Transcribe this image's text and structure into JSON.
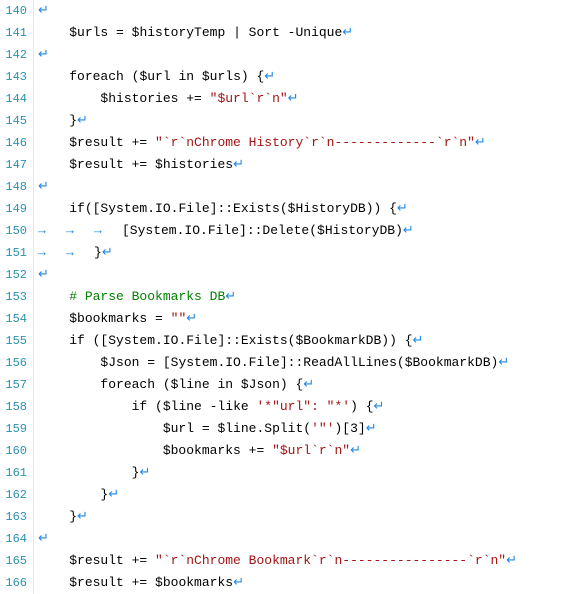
{
  "glyphs": {
    "eol": "↵",
    "tab": "→"
  },
  "lines": [
    {
      "num": 140,
      "indent": 0,
      "tabs": 0,
      "tokens": []
    },
    {
      "num": 141,
      "indent": 1,
      "tabs": 0,
      "tokens": [
        {
          "t": "var",
          "v": "$urls"
        },
        {
          "t": "plain",
          "v": " = "
        },
        {
          "t": "var",
          "v": "$historyTemp"
        },
        {
          "t": "plain",
          "v": " | Sort -Unique"
        }
      ]
    },
    {
      "num": 142,
      "indent": 0,
      "tabs": 0,
      "tokens": []
    },
    {
      "num": 143,
      "indent": 1,
      "tabs": 0,
      "tokens": [
        {
          "t": "kw",
          "v": "foreach"
        },
        {
          "t": "plain",
          "v": " ("
        },
        {
          "t": "var",
          "v": "$url"
        },
        {
          "t": "plain",
          "v": " in "
        },
        {
          "t": "var",
          "v": "$urls"
        },
        {
          "t": "plain",
          "v": ") {"
        }
      ]
    },
    {
      "num": 144,
      "indent": 2,
      "tabs": 0,
      "tokens": [
        {
          "t": "var",
          "v": "$histories"
        },
        {
          "t": "plain",
          "v": " += "
        },
        {
          "t": "str",
          "v": "\"$url`r`n\""
        }
      ]
    },
    {
      "num": 145,
      "indent": 1,
      "tabs": 0,
      "tokens": [
        {
          "t": "plain",
          "v": "}"
        }
      ]
    },
    {
      "num": 146,
      "indent": 1,
      "tabs": 0,
      "tokens": [
        {
          "t": "var",
          "v": "$result"
        },
        {
          "t": "plain",
          "v": " += "
        },
        {
          "t": "str",
          "v": "\"`r`nChrome History`r`n-------------`r`n\""
        }
      ]
    },
    {
      "num": 147,
      "indent": 1,
      "tabs": 0,
      "tokens": [
        {
          "t": "var",
          "v": "$result"
        },
        {
          "t": "plain",
          "v": " += "
        },
        {
          "t": "var",
          "v": "$histories"
        }
      ]
    },
    {
      "num": 148,
      "indent": 0,
      "tabs": 0,
      "tokens": []
    },
    {
      "num": 149,
      "indent": 1,
      "tabs": 0,
      "tokens": [
        {
          "t": "kw",
          "v": "if"
        },
        {
          "t": "plain",
          "v": "([System.IO.File]::Exists("
        },
        {
          "t": "var",
          "v": "$HistoryDB"
        },
        {
          "t": "plain",
          "v": ")) {"
        }
      ]
    },
    {
      "num": 150,
      "indent": 0,
      "tabs": 3,
      "tokens": [
        {
          "t": "plain",
          "v": "[System.IO.File]::Delete("
        },
        {
          "t": "var",
          "v": "$HistoryDB"
        },
        {
          "t": "plain",
          "v": ")"
        }
      ]
    },
    {
      "num": 151,
      "indent": 0,
      "tabs": 2,
      "tokens": [
        {
          "t": "plain",
          "v": "}"
        }
      ]
    },
    {
      "num": 152,
      "indent": 0,
      "tabs": 0,
      "tokens": []
    },
    {
      "num": 153,
      "indent": 1,
      "tabs": 0,
      "tokens": [
        {
          "t": "cmt",
          "v": "# Parse Bookmarks DB"
        }
      ]
    },
    {
      "num": 154,
      "indent": 1,
      "tabs": 0,
      "tokens": [
        {
          "t": "var",
          "v": "$bookmarks"
        },
        {
          "t": "plain",
          "v": " = "
        },
        {
          "t": "str",
          "v": "\"\""
        }
      ]
    },
    {
      "num": 155,
      "indent": 1,
      "tabs": 0,
      "tokens": [
        {
          "t": "kw",
          "v": "if"
        },
        {
          "t": "plain",
          "v": " ([System.IO.File]::Exists("
        },
        {
          "t": "var",
          "v": "$BookmarkDB"
        },
        {
          "t": "plain",
          "v": ")) {"
        }
      ]
    },
    {
      "num": 156,
      "indent": 2,
      "tabs": 0,
      "tokens": [
        {
          "t": "var",
          "v": "$Json"
        },
        {
          "t": "plain",
          "v": " = [System.IO.File]::ReadAllLines("
        },
        {
          "t": "var",
          "v": "$BookmarkDB"
        },
        {
          "t": "plain",
          "v": ")"
        }
      ]
    },
    {
      "num": 157,
      "indent": 2,
      "tabs": 0,
      "tokens": [
        {
          "t": "kw",
          "v": "foreach"
        },
        {
          "t": "plain",
          "v": " ("
        },
        {
          "t": "var",
          "v": "$line"
        },
        {
          "t": "plain",
          "v": " in "
        },
        {
          "t": "var",
          "v": "$Json"
        },
        {
          "t": "plain",
          "v": ") {"
        }
      ]
    },
    {
      "num": 158,
      "indent": 3,
      "tabs": 0,
      "tokens": [
        {
          "t": "kw",
          "v": "if"
        },
        {
          "t": "plain",
          "v": " ("
        },
        {
          "t": "var",
          "v": "$line"
        },
        {
          "t": "plain",
          "v": " -like "
        },
        {
          "t": "str",
          "v": "'*\"url\": \"*'"
        },
        {
          "t": "plain",
          "v": ") {"
        }
      ]
    },
    {
      "num": 159,
      "indent": 4,
      "tabs": 0,
      "tokens": [
        {
          "t": "var",
          "v": "$url"
        },
        {
          "t": "plain",
          "v": " = "
        },
        {
          "t": "var",
          "v": "$line"
        },
        {
          "t": "plain",
          "v": ".Split("
        },
        {
          "t": "str",
          "v": "'\"'"
        },
        {
          "t": "plain",
          "v": ")[3]"
        }
      ]
    },
    {
      "num": 160,
      "indent": 4,
      "tabs": 0,
      "tokens": [
        {
          "t": "var",
          "v": "$bookmarks"
        },
        {
          "t": "plain",
          "v": " += "
        },
        {
          "t": "str",
          "v": "\"$url`r`n\""
        }
      ]
    },
    {
      "num": 161,
      "indent": 3,
      "tabs": 0,
      "tokens": [
        {
          "t": "plain",
          "v": "}"
        }
      ]
    },
    {
      "num": 162,
      "indent": 2,
      "tabs": 0,
      "tokens": [
        {
          "t": "plain",
          "v": "}"
        }
      ]
    },
    {
      "num": 163,
      "indent": 1,
      "tabs": 0,
      "tokens": [
        {
          "t": "plain",
          "v": "}"
        }
      ]
    },
    {
      "num": 164,
      "indent": 0,
      "tabs": 0,
      "tokens": []
    },
    {
      "num": 165,
      "indent": 1,
      "tabs": 0,
      "tokens": [
        {
          "t": "var",
          "v": "$result"
        },
        {
          "t": "plain",
          "v": " += "
        },
        {
          "t": "str",
          "v": "\"`r`nChrome Bookmark`r`n----------------`r`n\""
        }
      ]
    },
    {
      "num": 166,
      "indent": 1,
      "tabs": 0,
      "tokens": [
        {
          "t": "var",
          "v": "$result"
        },
        {
          "t": "plain",
          "v": " += "
        },
        {
          "t": "var",
          "v": "$bookmarks"
        }
      ]
    }
  ]
}
